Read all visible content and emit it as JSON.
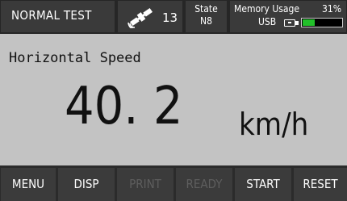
{
  "status_bar": {
    "mode": "NORMAL TEST",
    "satellite": {
      "icon": "satellite-icon",
      "count": "13"
    },
    "state": {
      "label": "State",
      "value": "N8"
    },
    "memory": {
      "label": "Memory Usage",
      "percent_text": "31%",
      "usage_fraction": 0.31,
      "device": "USB",
      "device_icon": "usb-stick-icon"
    }
  },
  "measurement": {
    "label": "Horizontal Speed",
    "value": "40. 2",
    "unit": "km/h"
  },
  "softkeys": [
    {
      "label": "MENU",
      "enabled": true
    },
    {
      "label": "DISP",
      "enabled": true
    },
    {
      "label": "PRINT",
      "enabled": false
    },
    {
      "label": "READY",
      "enabled": false
    },
    {
      "label": "START",
      "enabled": true
    },
    {
      "label": "RESET",
      "enabled": true
    }
  ],
  "colors": {
    "memory_fill": "#22c02a",
    "panel_background": "#c3c3c3",
    "disabled_text": "#5e5e5e"
  }
}
